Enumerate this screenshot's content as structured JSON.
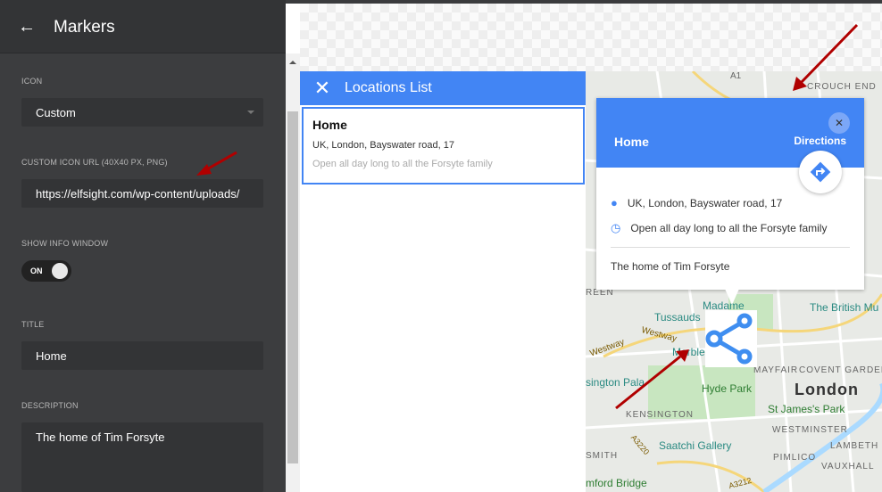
{
  "panel": {
    "title": "Markers",
    "back_icon": "arrow-left-icon",
    "icon_label": "ICON",
    "icon_value": "Custom",
    "url_label": "CUSTOM ICON URL (40X40 PX, PNG)",
    "url_value": "https://elfsight.com/wp-content/uploads/",
    "info_label": "SHOW INFO WINDOW",
    "toggle": "ON",
    "toggle_on": true,
    "title_label": "TITLE",
    "title_value": "Home",
    "desc_label": "DESCRIPTION",
    "desc_value": "The home of Tim Forsyte"
  },
  "locations": {
    "title": "Locations List",
    "items": [
      {
        "name": "Home",
        "address": "UK, London, Bayswater road, 17",
        "hours": "Open all day long to all the Forsyte family"
      }
    ]
  },
  "infowindow": {
    "title": "Home",
    "directions": "Directions",
    "address": "UK, London, Bayswater road, 17",
    "hours": "Open all day long to all the Forsyte family",
    "description": "The home of Tim Forsyte"
  },
  "map_labels": [
    "CROUCH END",
    "A1",
    "Madame",
    "Tussauds",
    "Westway",
    "Westway",
    "Marble",
    "Hyde Park",
    "MAYFAIR",
    "COVENT GARDEN",
    "London",
    "St James's Park",
    "KENSINGTON",
    "WESTMINSTER",
    "LAMBETH",
    "Saatchi Gallery",
    "PIMLICO",
    "VAUXHALL",
    "The British Mu",
    "sington Pala",
    "mford Bridge",
    "SMITH",
    "REEN",
    "A3220",
    "A3212"
  ],
  "colors": {
    "accent": "#4285f4",
    "panel": "#3c3d3f",
    "arrow": "#b00000"
  }
}
